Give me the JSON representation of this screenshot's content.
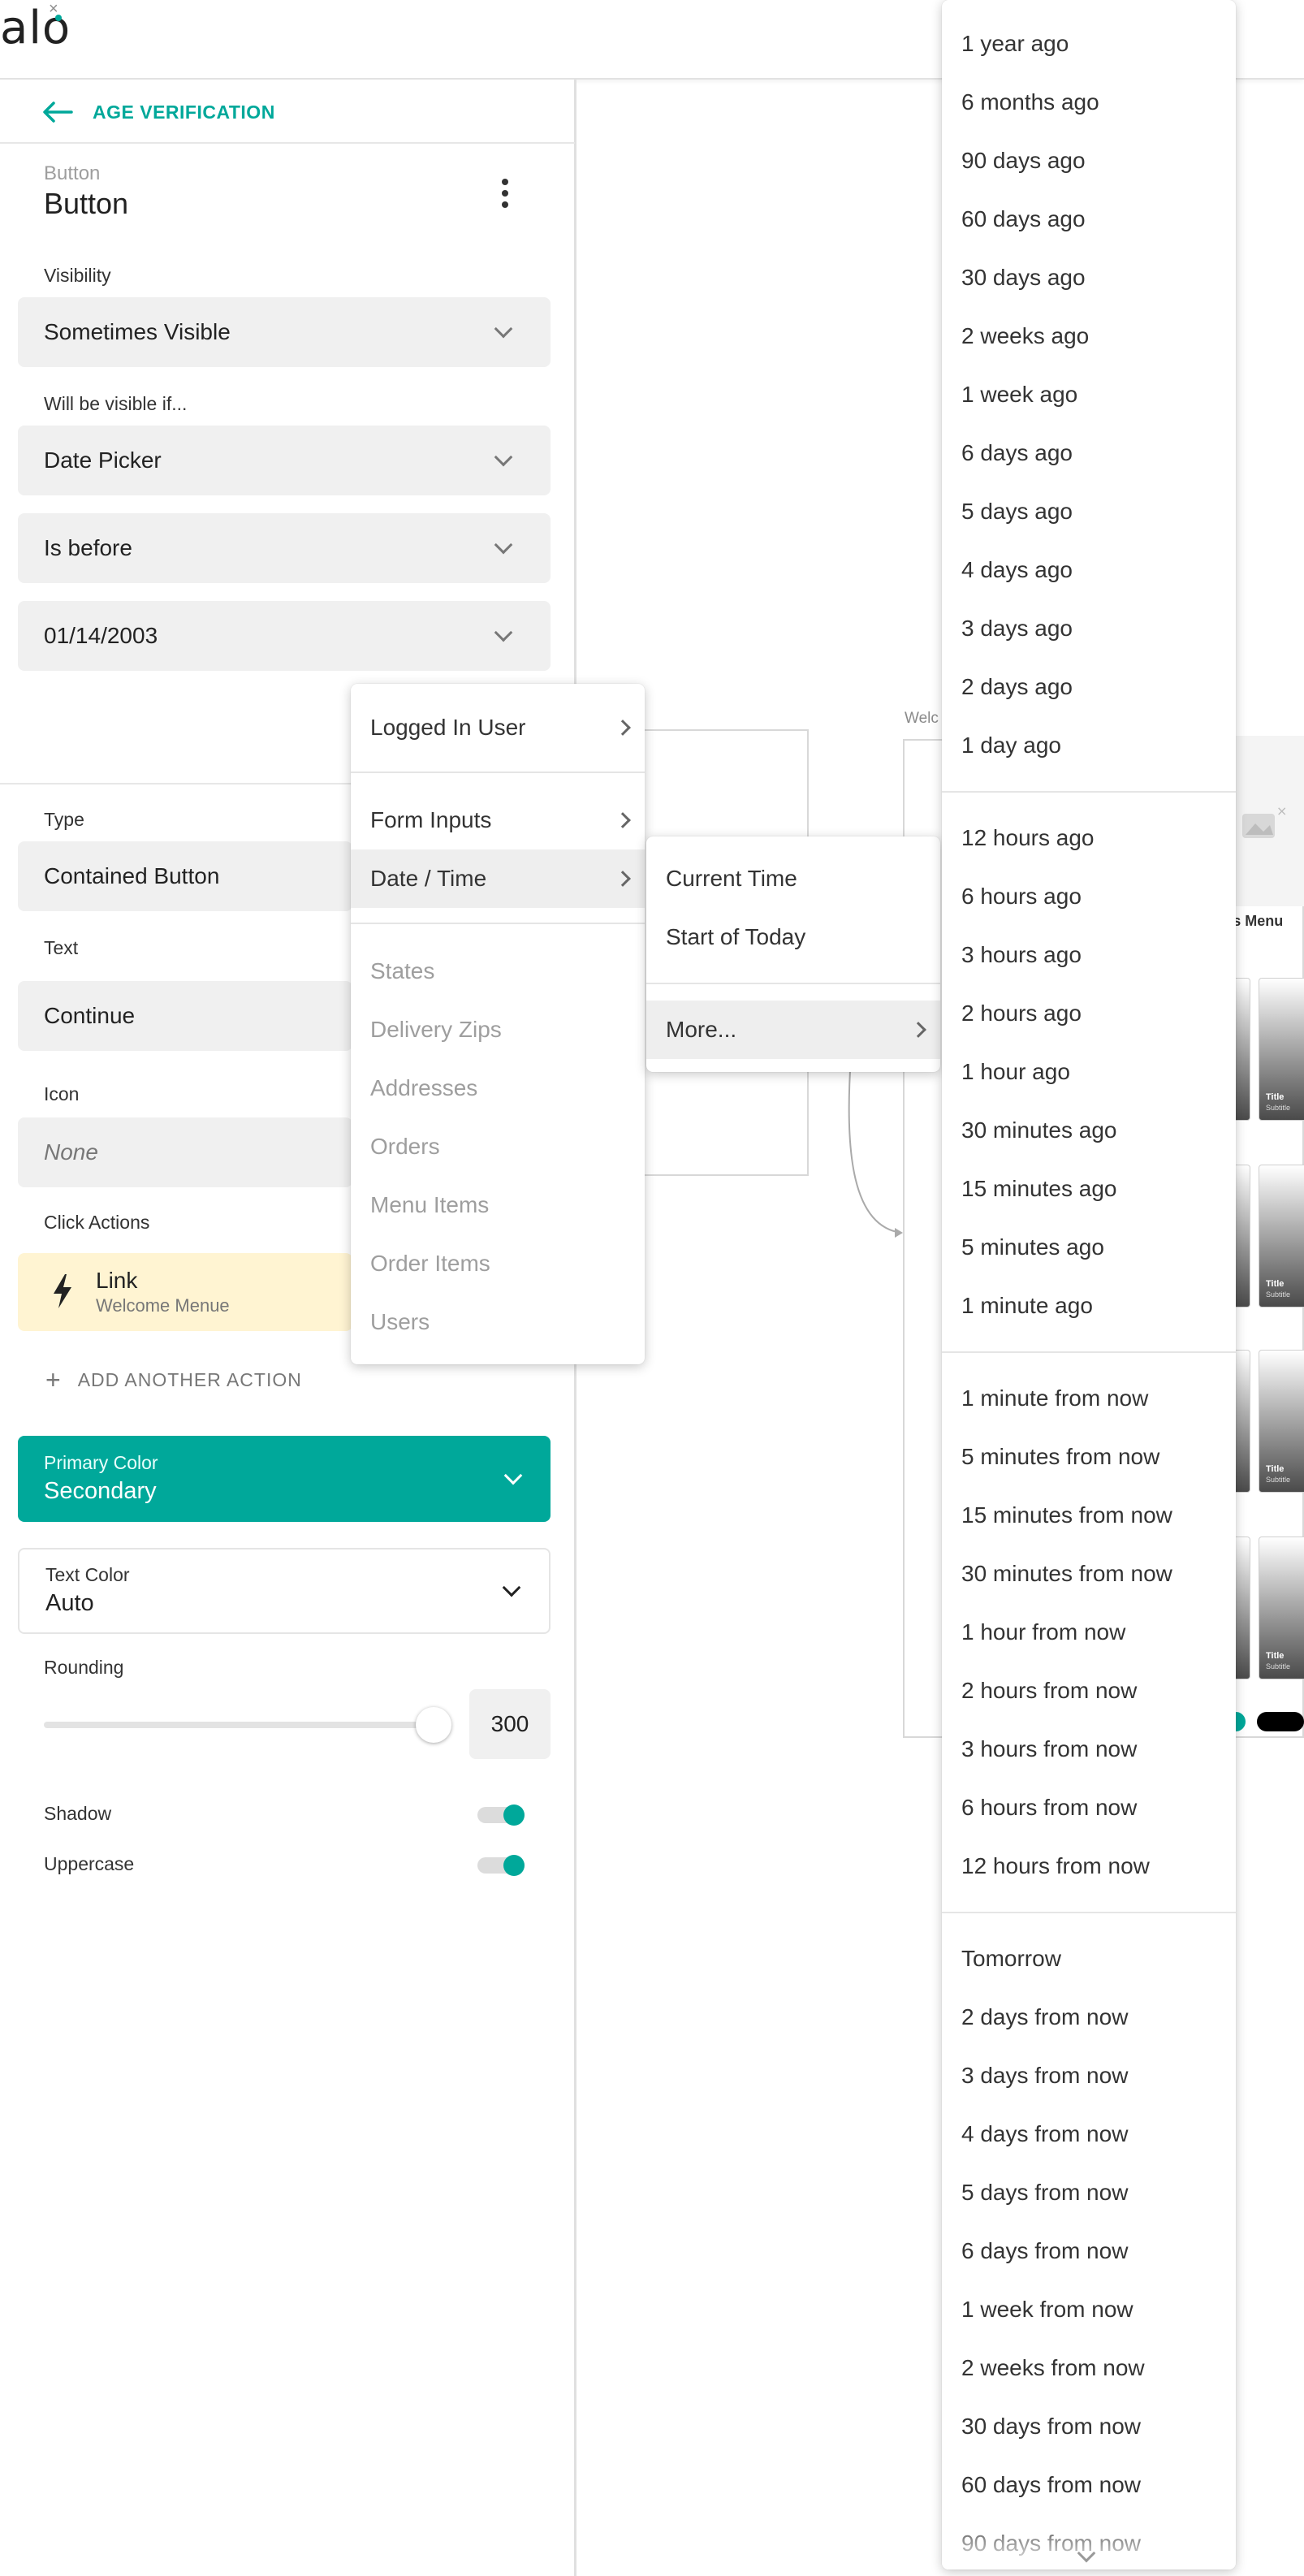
{
  "app": {
    "logo_text": "alo"
  },
  "header": {
    "back_label": "AGE VERIFICATION"
  },
  "component": {
    "type_label": "Button",
    "title": "Button"
  },
  "visibility": {
    "label": "Visibility",
    "value": "Sometimes Visible",
    "condition_label": "Will be visible if...",
    "source": "Date Picker",
    "operator": "Is before",
    "comparison": "01/14/2003"
  },
  "props": {
    "type_label": "Type",
    "type_value": "Contained Button",
    "text_label": "Text",
    "text_value": "Continue",
    "icon_label": "Icon",
    "icon_value": "None",
    "click_actions_label": "Click Actions",
    "action": {
      "title": "Link",
      "subtitle": "Welcome Menue"
    },
    "add_action_label": "ADD ANOTHER ACTION",
    "primary_color_label": "Primary Color",
    "primary_color_value": "Secondary",
    "text_color_label": "Text Color",
    "text_color_value": "Auto",
    "rounding_label": "Rounding",
    "rounding_value": "300",
    "shadow_label": "Shadow",
    "shadow_on": true,
    "uppercase_label": "Uppercase",
    "uppercase_on": true
  },
  "canvas": {
    "screen_label": "Welc",
    "menu_label": "y's Menu",
    "thumb_title": "Title",
    "thumb_subtitle": "Subtitle"
  },
  "menu1": {
    "items": [
      "Logged In User",
      "Form Inputs",
      "Date / Time",
      "States",
      "Delivery Zips",
      "Addresses",
      "Orders",
      "Menu Items",
      "Order Items",
      "Users"
    ]
  },
  "menu2": {
    "items": [
      "Current Time",
      "Start of Today",
      "More..."
    ]
  },
  "menu3": {
    "items": [
      "1 year ago",
      "6 months ago",
      "90 days ago",
      "60 days ago",
      "30 days ago",
      "2 weeks ago",
      "1 week ago",
      "6 days ago",
      "5 days ago",
      "4 days ago",
      "3 days ago",
      "2 days ago",
      "1 day ago",
      "12 hours ago",
      "6 hours ago",
      "3 hours ago",
      "2 hours ago",
      "1 hour ago",
      "30 minutes ago",
      "15 minutes ago",
      "5 minutes ago",
      "1 minute ago",
      "1 minute from now",
      "5 minutes from now",
      "15 minutes from now",
      "30 minutes from now",
      "1 hour from now",
      "2 hours from now",
      "3 hours from now",
      "6 hours from now",
      "12 hours from now",
      "Tomorrow",
      "2 days from now",
      "3 days from now",
      "4 days from now",
      "5 days from now",
      "6 days from now",
      "1 week from now",
      "2 weeks from now",
      "30 days from now",
      "60 days from now",
      "90 days from now"
    ]
  },
  "colors": {
    "accent": "#00a89a",
    "action_bg": "#fff4d2",
    "field_bg": "#f0f0f0"
  }
}
